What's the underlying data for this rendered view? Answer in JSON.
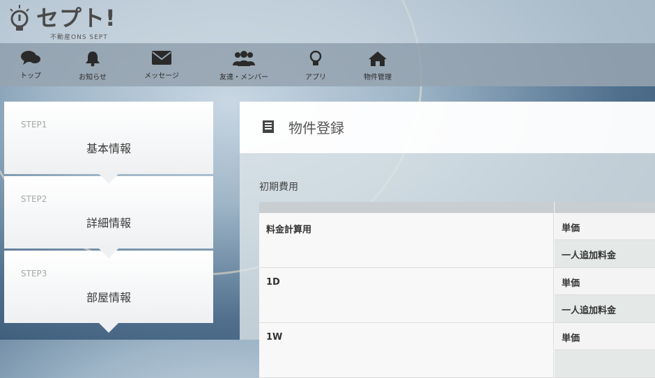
{
  "header": {
    "brand": "セプト!",
    "tagline": "不動産ONS SEPT"
  },
  "nav": {
    "items": [
      {
        "label": "トップ",
        "icon": "comments-icon"
      },
      {
        "label": "お知らせ",
        "icon": "bell-icon"
      },
      {
        "label": "メッセージ",
        "icon": "envelope-icon"
      },
      {
        "label": "友達・メンバー",
        "icon": "users-icon"
      },
      {
        "label": "アプリ",
        "icon": "lightbulb-icon"
      },
      {
        "label": "物件管理",
        "icon": "home-icon"
      }
    ]
  },
  "steps": [
    {
      "step": "STEP1",
      "title": "基本情報"
    },
    {
      "step": "STEP2",
      "title": "詳細情報"
    },
    {
      "step": "STEP3",
      "title": "部屋情報"
    }
  ],
  "main": {
    "title": "物件登録",
    "section_title": "初期費用",
    "rows": [
      {
        "name": "料金計算用",
        "col1": "単価",
        "col2": "一人追加料金"
      },
      {
        "name": "1D",
        "col1": "単価",
        "col2": "一人追加料金"
      },
      {
        "name": "1W",
        "col1": "単価",
        "col2": ""
      }
    ]
  },
  "colors": {
    "nav_bg": "#96a4b0",
    "panel_bg": "#ffffff",
    "table_header": "#c9ced3"
  }
}
